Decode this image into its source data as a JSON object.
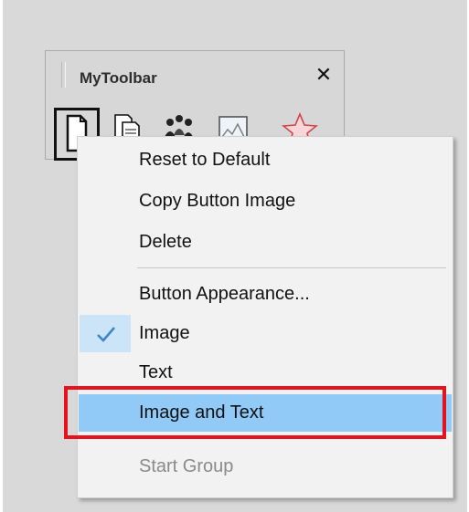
{
  "toolbar": {
    "title": "MyToolbar",
    "close_symbol": "✕",
    "buttons": [
      {
        "icon": "document-icon",
        "selected": true
      },
      {
        "icon": "copy-document-icon",
        "selected": false
      },
      {
        "icon": "people-group-icon",
        "selected": false
      },
      {
        "icon": "image-chart-icon",
        "selected": false
      },
      {
        "icon": "star-icon",
        "selected": false
      }
    ]
  },
  "context_menu": {
    "items": [
      {
        "label": "Reset to Default",
        "enabled": true
      },
      {
        "label": "Copy Button Image",
        "enabled": true
      },
      {
        "label": "Delete",
        "enabled": true
      },
      {
        "label": "Button Appearance...",
        "enabled": true
      },
      {
        "label": "Image",
        "enabled": true,
        "checked": true
      },
      {
        "label": "Text",
        "enabled": true
      },
      {
        "label": "Image and Text",
        "enabled": true,
        "highlighted": true
      },
      {
        "label": "Start Group",
        "enabled": false
      }
    ]
  },
  "colors": {
    "highlight": "#91c9f7",
    "annotation_box": "#e8121e",
    "check": "#3c86c8"
  }
}
